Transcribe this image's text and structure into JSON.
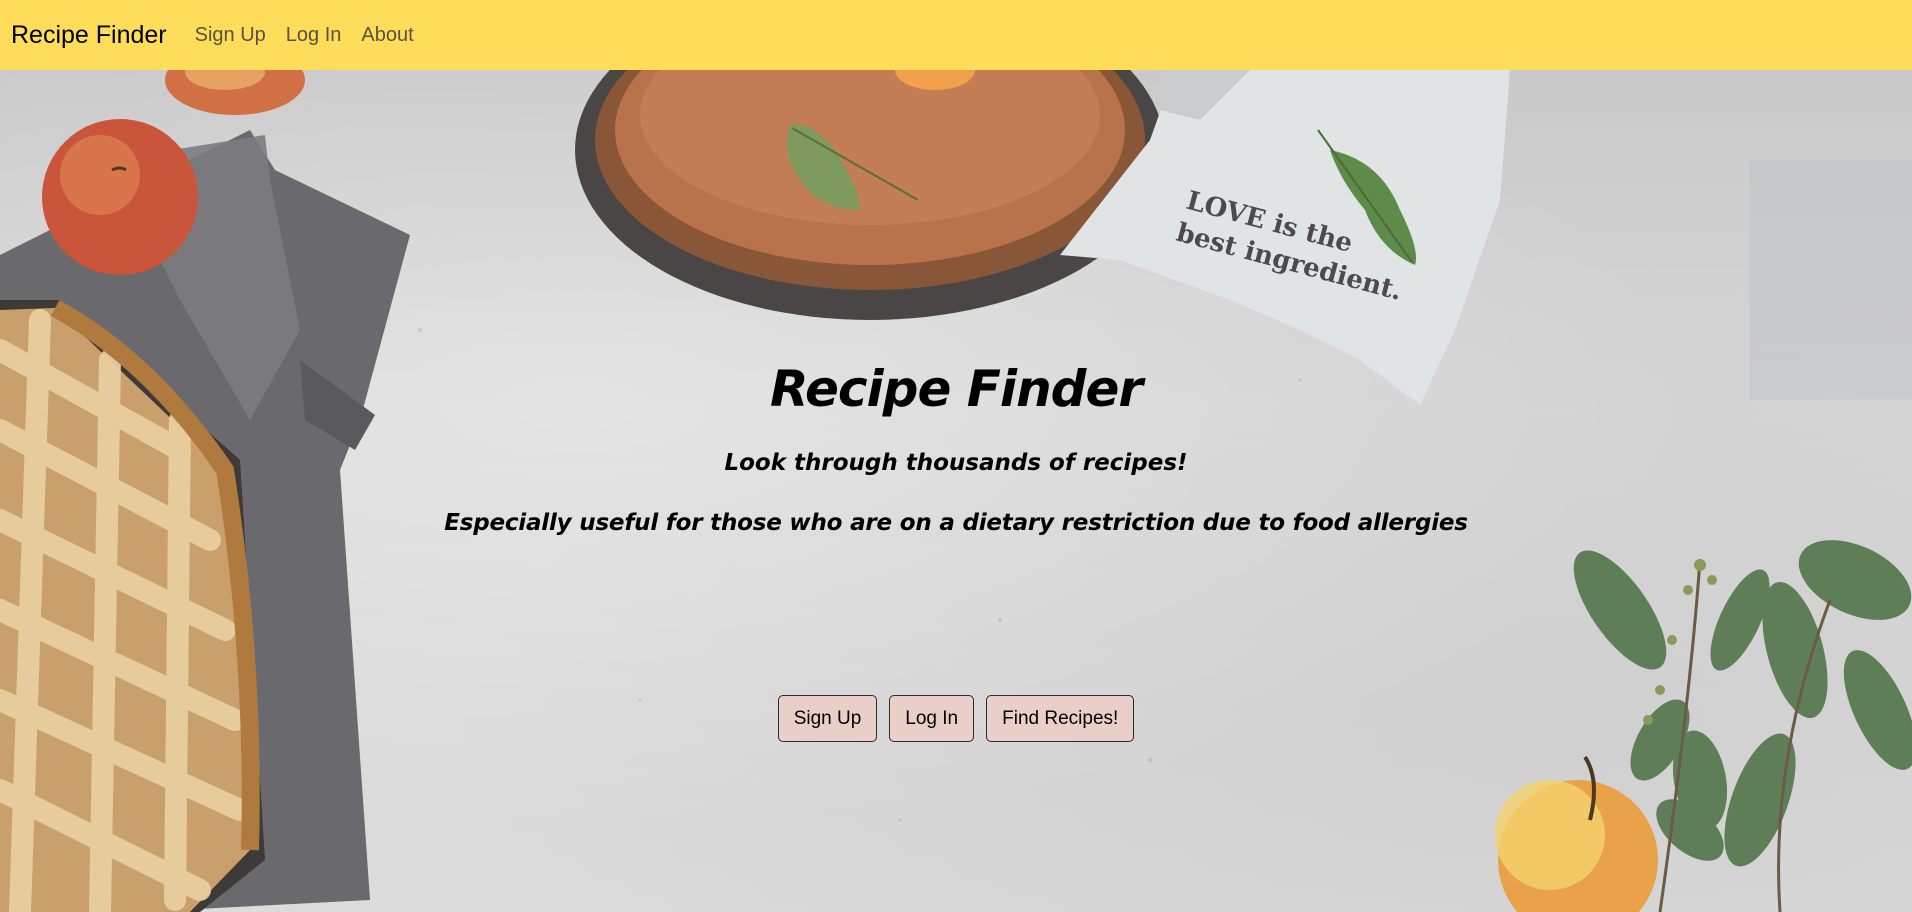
{
  "navbar": {
    "brand": "Recipe Finder",
    "links": [
      "Sign Up",
      "Log In",
      "About"
    ]
  },
  "hero": {
    "title": "Recipe Finder",
    "subtitle": "Look through thousands of recipes!",
    "tagline": "Especially useful for those who are on a dietary restriction due to food allergies",
    "buttons": [
      "Sign Up",
      "Log In",
      "Find Recipes!"
    ]
  },
  "background": {
    "napkin_text_line1": "LOVE is the",
    "napkin_text_line2": "best ingredient."
  },
  "colors": {
    "navbar_bg": "#fedd5b",
    "button_bg": "#e9cfc8",
    "background": "#d6d6d6"
  }
}
